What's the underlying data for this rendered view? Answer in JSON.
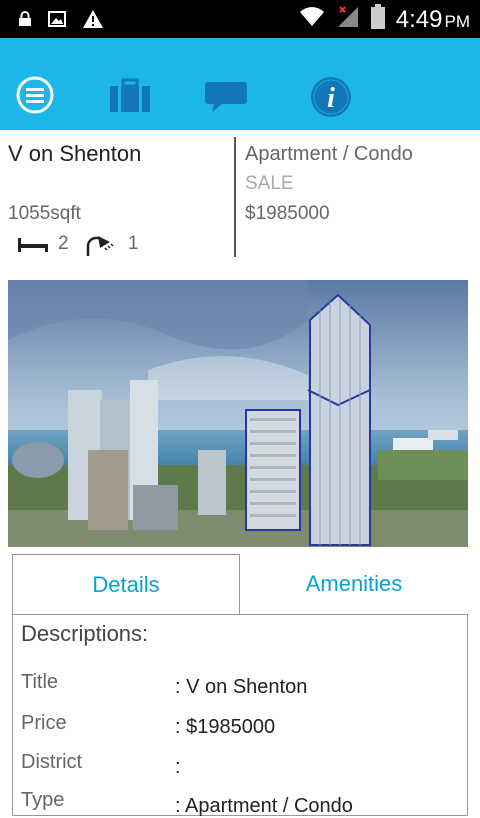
{
  "status": {
    "time": "4:49",
    "ampm": "PM"
  },
  "nav": {
    "menu": "menu-icon",
    "listings": "briefcase-icon",
    "chat": "chat-icon",
    "info": "info-icon"
  },
  "property": {
    "name": "V on Shenton",
    "type": "Apartment / Condo",
    "listing": "SALE",
    "size": "1055sqft",
    "price": "$1985000",
    "beds": "2",
    "baths": "1"
  },
  "tabs": {
    "details": "Details",
    "amenities": "Amenities"
  },
  "details": {
    "heading": "Descriptions:",
    "rows": [
      {
        "label": "Title",
        "value": ": V on Shenton"
      },
      {
        "label": "Price",
        "value": ": $1985000"
      },
      {
        "label": "District",
        "value": ":"
      },
      {
        "label": "Type",
        "value": ": Apartment / Condo"
      }
    ]
  },
  "colors": {
    "accent": "#1db6e8",
    "tab_text": "#0aa1cf"
  }
}
